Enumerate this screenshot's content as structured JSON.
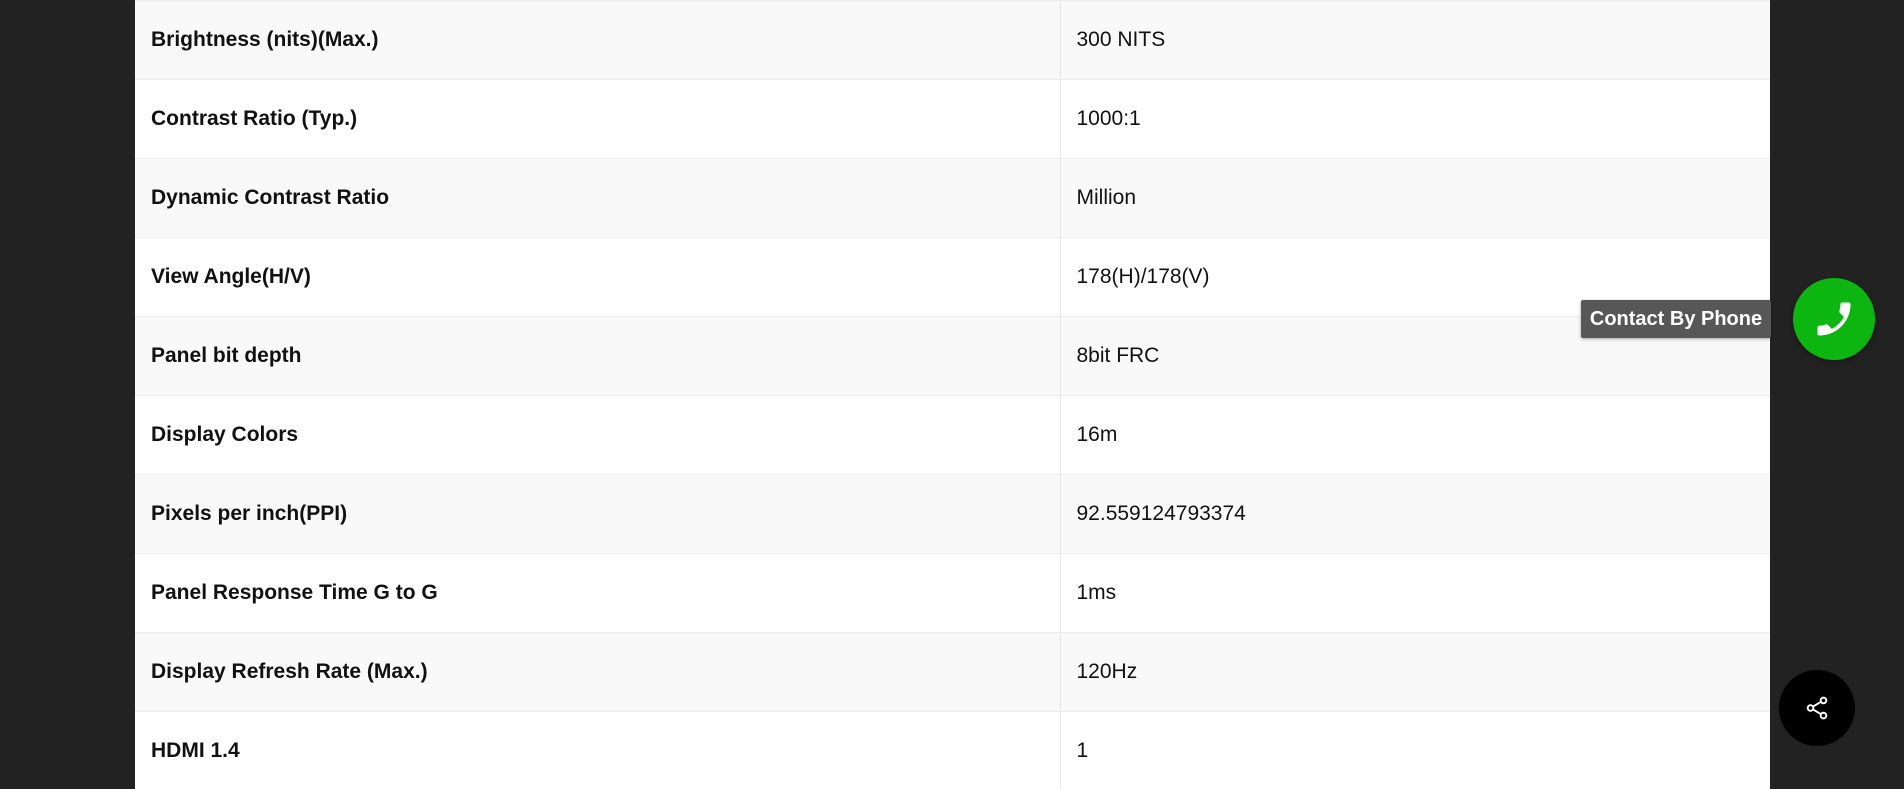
{
  "specs": {
    "rows": [
      {
        "label": "Brightness (nits)(Max.)",
        "value": "300 NITS"
      },
      {
        "label": "Contrast Ratio (Typ.)",
        "value": "1000:1"
      },
      {
        "label": "Dynamic Contrast Ratio",
        "value": "Million"
      },
      {
        "label": "View Angle(H/V)",
        "value": "178(H)/178(V)"
      },
      {
        "label": "Panel bit depth",
        "value": "8bit FRC"
      },
      {
        "label": "Display Colors",
        "value": "16m"
      },
      {
        "label": "Pixels per inch(PPI)",
        "value": "92.559124793374"
      },
      {
        "label": "Panel Response Time G to G",
        "value": "1ms"
      },
      {
        "label": "Display Refresh Rate (Max.)",
        "value": "120Hz"
      },
      {
        "label": "HDMI 1.4",
        "value": "1"
      }
    ]
  },
  "contact": {
    "tooltip": "Contact By Phone",
    "icon": "phone-icon",
    "color": "#0db511"
  },
  "share": {
    "icon": "share-icon",
    "color": "#000000"
  }
}
